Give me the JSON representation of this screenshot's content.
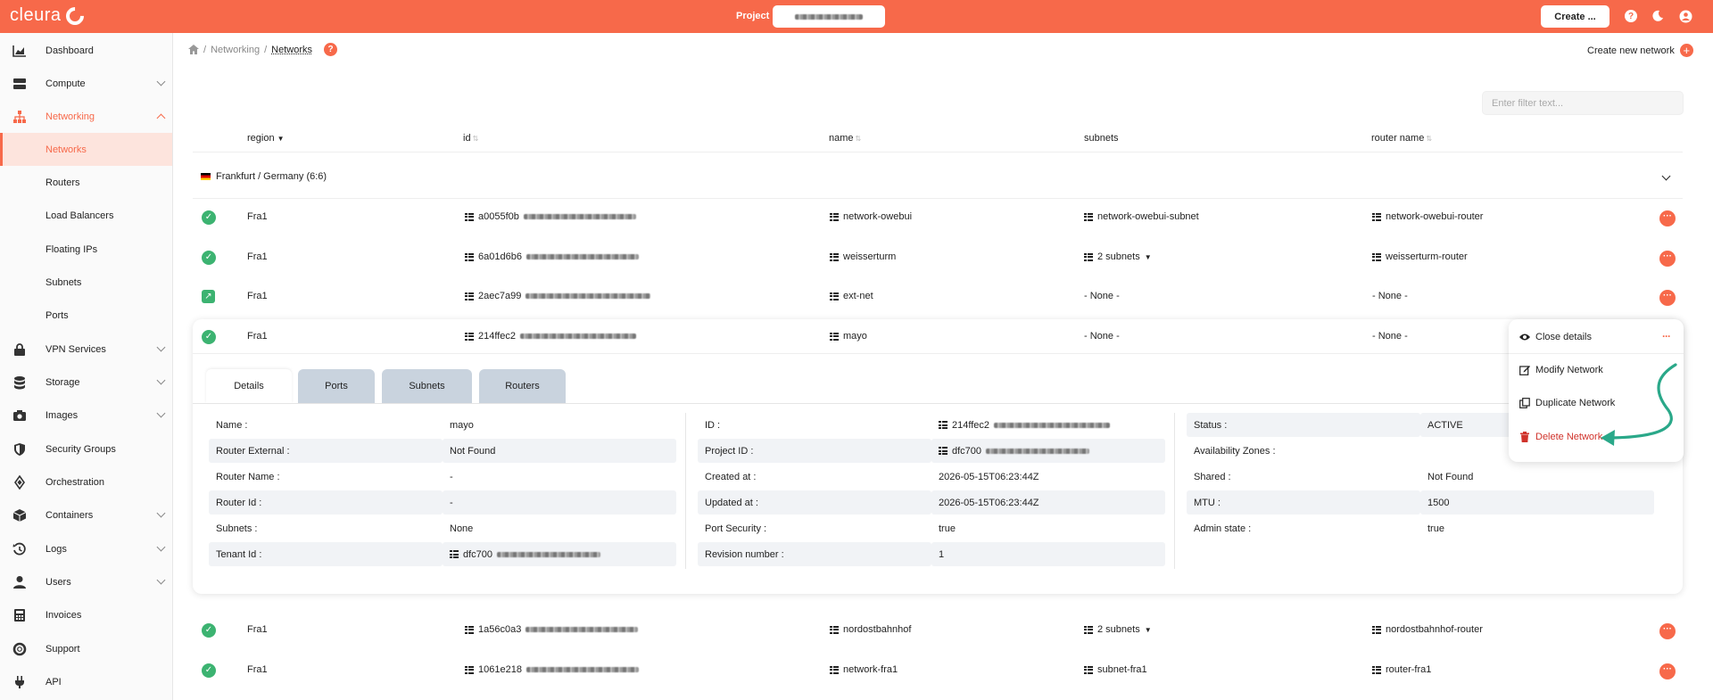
{
  "brand": {
    "name": "cleura"
  },
  "topbar": {
    "project_label": "Project",
    "create_label": "Create ...",
    "help_icon": "question-circle-icon",
    "theme_icon": "moon-icon",
    "user_icon": "user-circle-icon"
  },
  "sidebar": {
    "items": [
      {
        "label": "Dashboard",
        "icon": "chart-icon",
        "chevron": false
      },
      {
        "label": "Compute",
        "icon": "server-icon",
        "chevron": true
      },
      {
        "label": "Networking",
        "icon": "network-icon",
        "chevron": true,
        "expanded": true
      },
      {
        "label": "Networks",
        "child": true,
        "active": true
      },
      {
        "label": "Routers",
        "child": true
      },
      {
        "label": "Load Balancers",
        "child": true
      },
      {
        "label": "Floating IPs",
        "child": true
      },
      {
        "label": "Subnets",
        "child": true
      },
      {
        "label": "Ports",
        "child": true
      },
      {
        "label": "VPN Services",
        "icon": "lock-icon",
        "chevron": true
      },
      {
        "label": "Storage",
        "icon": "database-icon",
        "chevron": true
      },
      {
        "label": "Images",
        "icon": "camera-icon",
        "chevron": true
      },
      {
        "label": "Security Groups",
        "icon": "shield-icon",
        "chevron": false
      },
      {
        "label": "Orchestration",
        "icon": "orchestration-icon",
        "chevron": false
      },
      {
        "label": "Containers",
        "icon": "cube-icon",
        "chevron": true
      },
      {
        "label": "Logs",
        "icon": "history-icon",
        "chevron": true
      },
      {
        "label": "Users",
        "icon": "user-icon",
        "chevron": true
      },
      {
        "label": "Invoices",
        "icon": "calculator-icon",
        "chevron": false
      },
      {
        "label": "Support",
        "icon": "lifebuoy-icon",
        "chevron": false
      },
      {
        "label": "API",
        "icon": "plug-icon",
        "chevron": false
      }
    ]
  },
  "breadcrumb": {
    "sep": "/",
    "parent": "Networking",
    "current": "Networks"
  },
  "create_network_label": "Create new network",
  "filter": {
    "placeholder": "Enter filter text..."
  },
  "table": {
    "headers": {
      "region": "region",
      "id": "id",
      "name": "name",
      "subnets": "subnets",
      "router": "router name"
    },
    "group": "Frankfurt / Germany (6:6)",
    "rows": [
      {
        "status": "ok",
        "region": "Fra1",
        "id": "a0055f0b",
        "name": "network-owebui",
        "subnets": "network-owebui-subnet",
        "subnets_icon": true,
        "subnets_dropdown": false,
        "router": "network-owebui-router",
        "router_icon": true
      },
      {
        "status": "ok",
        "region": "Fra1",
        "id": "6a01d6b6",
        "name": "weisserturm",
        "subnets": "2 subnets",
        "subnets_icon": true,
        "subnets_dropdown": true,
        "router": "weisserturm-router",
        "router_icon": true
      },
      {
        "status": "external",
        "region": "Fra1",
        "id": "2aec7a99",
        "name": "ext-net",
        "subnets": "- None -",
        "subnets_icon": false,
        "subnets_dropdown": false,
        "router": "- None -",
        "router_icon": false
      },
      {
        "status": "ok",
        "region": "Fra1",
        "id": "214ffec2",
        "name": "mayo",
        "subnets": "- None -",
        "subnets_icon": false,
        "subnets_dropdown": false,
        "router": "- None -",
        "router_icon": false
      },
      {
        "status": "ok",
        "region": "Fra1",
        "id": "1a56c0a3",
        "name": "nordostbahnhof",
        "subnets": "2 subnets",
        "subnets_icon": true,
        "subnets_dropdown": true,
        "router": "nordostbahnhof-router",
        "router_icon": true
      },
      {
        "status": "ok",
        "region": "Fra1",
        "id": "1061e218",
        "name": "network-fra1",
        "subnets": "subnet-fra1",
        "subnets_icon": true,
        "subnets_dropdown": false,
        "router": "router-fra1",
        "router_icon": true
      }
    ]
  },
  "details": {
    "tabs": [
      "Details",
      "Ports",
      "Subnets",
      "Routers"
    ],
    "col1": [
      {
        "k": "Name :",
        "v": "mayo"
      },
      {
        "k": "Router External :",
        "v": "Not Found"
      },
      {
        "k": "Router Name :",
        "v": "-"
      },
      {
        "k": "Router Id :",
        "v": "-"
      },
      {
        "k": "Subnets :",
        "v": "None"
      },
      {
        "k": "Tenant Id :",
        "v": "dfc700",
        "icon": true
      }
    ],
    "col2": [
      {
        "k": "ID :",
        "v": "214ffec2",
        "icon": true
      },
      {
        "k": "Project ID :",
        "v": "dfc700",
        "icon": true
      },
      {
        "k": "Created at :",
        "v": "2026-05-15T06:23:44Z"
      },
      {
        "k": "Updated at :",
        "v": "2026-05-15T06:23:44Z"
      },
      {
        "k": "Port Security :",
        "v": "true"
      },
      {
        "k": "Revision number :",
        "v": "1"
      }
    ],
    "col3": [
      {
        "k": "Status :",
        "v": "ACTIVE"
      },
      {
        "k": "Availability Zones :",
        "v": ""
      },
      {
        "k": "Shared :",
        "v": "Not Found"
      },
      {
        "k": "MTU :",
        "v": "1500"
      },
      {
        "k": "Admin state :",
        "v": "true"
      }
    ]
  },
  "menu": {
    "close": "Close details",
    "modify": "Modify Network",
    "duplicate": "Duplicate Network",
    "delete": "Delete Network"
  },
  "colors": {
    "brand": "#f7694a",
    "ok": "#3cb371",
    "danger": "#d0332b",
    "annotation_arrow": "#2aa889"
  }
}
